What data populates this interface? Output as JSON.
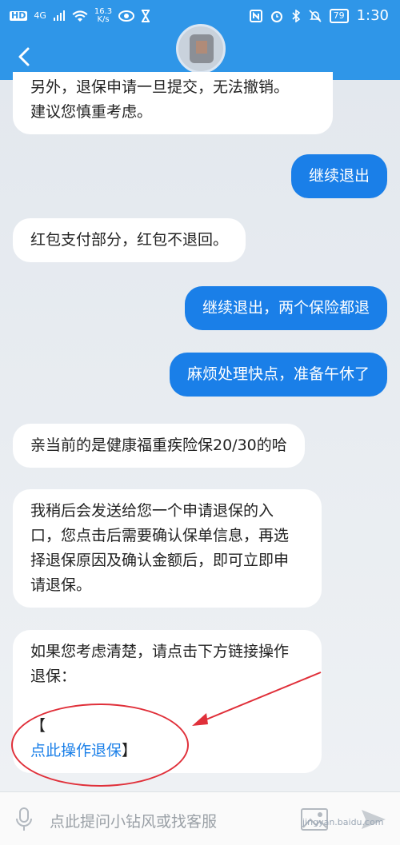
{
  "status_bar": {
    "hd": "HD",
    "net": "4G",
    "speed_top": "16.3",
    "speed_bottom": "K/s",
    "battery": "79",
    "time": "1:30"
  },
  "header": {
    "back_icon": "chevron-left-icon"
  },
  "messages": [
    {
      "from": "bot",
      "text_1": "另外，退保申请一旦提交，无法撤销。",
      "text_2": "建议您慎重考虑。"
    },
    {
      "from": "me",
      "text": "继续退出"
    },
    {
      "from": "bot",
      "text": "红包支付部分，红包不退回。"
    },
    {
      "from": "me",
      "text": "继续退出，两个保险都退"
    },
    {
      "from": "me",
      "text": "麻烦处理快点，准备午休了"
    },
    {
      "from": "bot",
      "text": "亲当前的是健康福重疾险保20/30的哈"
    },
    {
      "from": "bot",
      "lines": [
        "我稍后会发送给您一个申请退保的入",
        "口，您点击后需要确认保单信息，再选",
        "择退保原因及确认金额后，即可立即申",
        "请退保。"
      ]
    },
    {
      "from": "bot",
      "line_1": "如果您考虑清楚，请点击下方链接操作",
      "line_2": "退保：",
      "bracket_open": "【",
      "link": "点此操作退保",
      "bracket_close": "】"
    }
  ],
  "input": {
    "placeholder": "点此提问小钻风或找客服",
    "mic_icon": "microphone-icon",
    "image_icon": "image-icon",
    "send_icon": "send-icon"
  },
  "watermark": "jingyan.baidu.com",
  "colors": {
    "header": "#2f96e8",
    "bubble_me": "#1a7fe8",
    "bubble_bot": "#ffffff",
    "annotation": "#e0303a"
  }
}
